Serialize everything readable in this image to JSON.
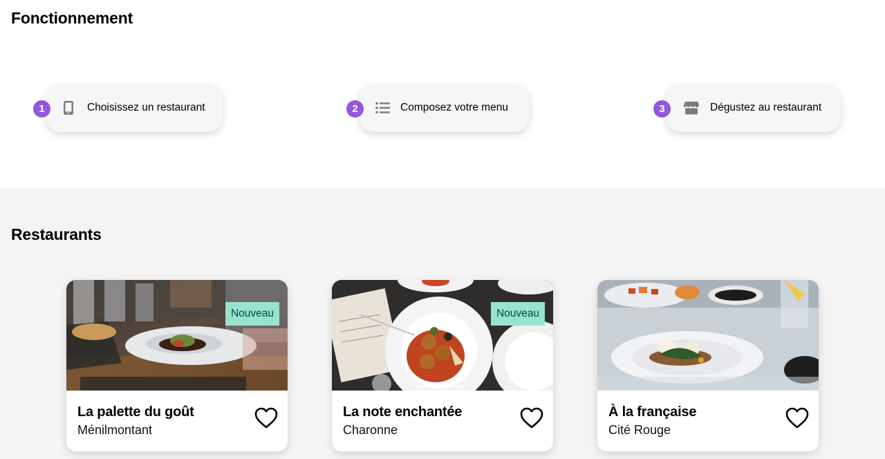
{
  "how_it_works": {
    "title": "Fonctionnement",
    "steps": [
      {
        "number": "1",
        "icon": "smartphone-icon",
        "label": "Choisissez un restaurant"
      },
      {
        "number": "2",
        "icon": "list-icon",
        "label": "Composez votre menu"
      },
      {
        "number": "3",
        "icon": "store-icon",
        "label": "Dégustez au restaurant"
      }
    ]
  },
  "restaurants": {
    "title": "Restaurants",
    "cards": [
      {
        "name": "La palette du goût",
        "location": "Ménilmontant",
        "badge": "Nouveau"
      },
      {
        "name": "La note enchantée",
        "location": "Charonne",
        "badge": "Nouveau"
      },
      {
        "name": "À la française",
        "location": "Cité Rouge",
        "badge": ""
      }
    ]
  },
  "colors": {
    "step_number_bg": "#9356dc",
    "badge_bg": "#99e2d0",
    "restaurants_bg": "#f4f4f4"
  }
}
